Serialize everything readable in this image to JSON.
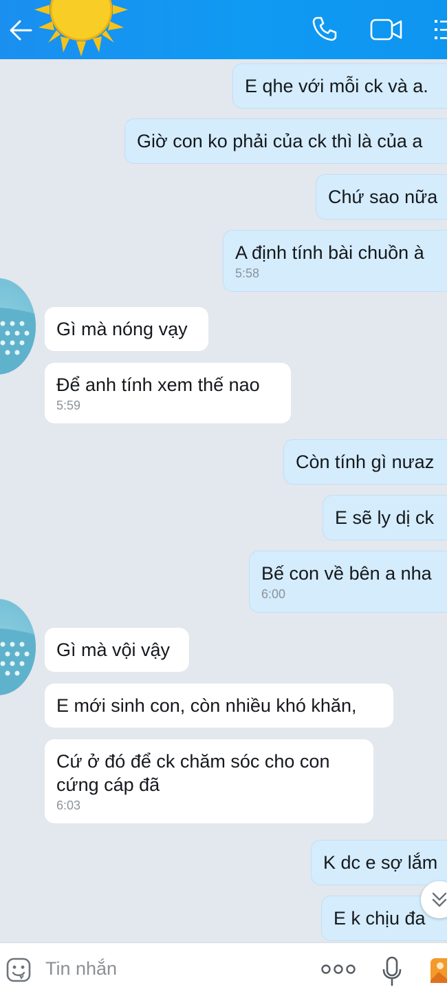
{
  "header": {
    "back_icon": "arrow-left-icon",
    "call_icon": "phone-icon",
    "video_icon": "video-camera-icon",
    "menu_icon": "list-icon"
  },
  "messages": [
    {
      "dir": "out",
      "text": "E qhe với mỗi ck và a."
    },
    {
      "dir": "out",
      "text": "Giờ con ko phải của ck thì là của a"
    },
    {
      "dir": "out",
      "text": "Chứ sao nữa"
    },
    {
      "dir": "out",
      "text": "A định tính bài chuồn à",
      "time": "5:58"
    },
    {
      "dir": "in",
      "text": "Gì mà nóng vạy"
    },
    {
      "dir": "in",
      "text": "Để anh tính xem thế nao",
      "time": "5:59"
    },
    {
      "dir": "out",
      "text": "Còn tính gì nưaz"
    },
    {
      "dir": "out",
      "text": "E sẽ ly dị ck"
    },
    {
      "dir": "out",
      "text": "Bế con về bên a nha",
      "time": "6:00"
    },
    {
      "dir": "in",
      "text": "Gì mà vội vậy"
    },
    {
      "dir": "in",
      "text": "E mới sinh con, còn nhiều khó khăn,"
    },
    {
      "dir": "in",
      "text": "Cứ ở đó để ck chăm sóc cho con cứng cáp đã",
      "time": "6:03"
    },
    {
      "dir": "out",
      "text": "K dc e sợ lắm"
    },
    {
      "dir": "out",
      "text": "E k chịu đa"
    }
  ],
  "input": {
    "placeholder": "Tin nhắn",
    "emoji_icon": "emoji-icon",
    "more_icon": "more-dots-icon",
    "mic_icon": "microphone-icon",
    "image_icon": "image-icon"
  },
  "scroll_icon": "chevron-down-icon",
  "colors": {
    "header": "#1a8ff0",
    "chat_bg": "#e3e7ee",
    "outgoing_bubble": "#d4ecfc",
    "incoming_bubble": "#ffffff",
    "timestamp": "#8d939a",
    "avatar": "#7fc6db"
  }
}
